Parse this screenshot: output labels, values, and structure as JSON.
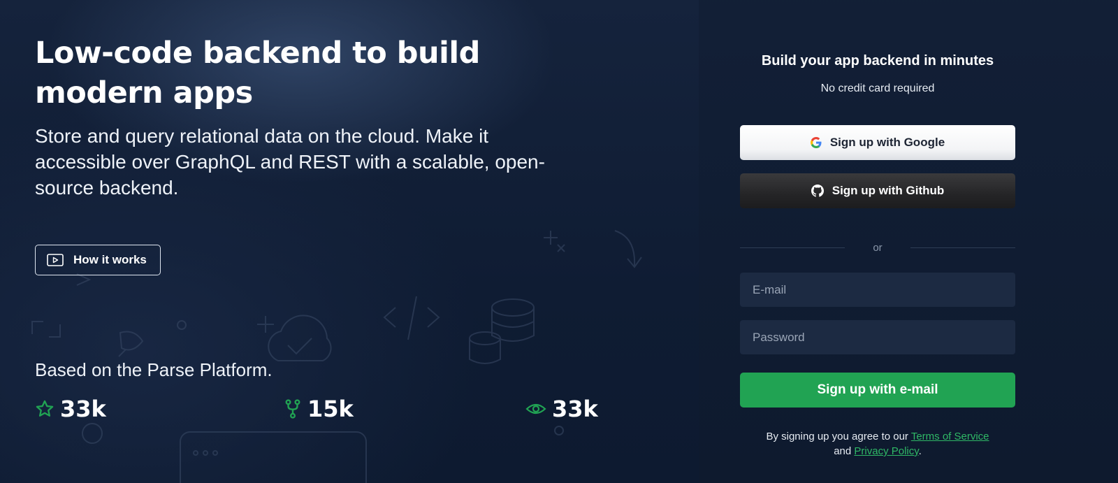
{
  "hero": {
    "headline": "Low-code backend to build modern apps",
    "subheadline": "Store and query relational data on the cloud. Make it accessible over GraphQL and REST with a scalable, open-source backend.",
    "how_it_works_label": "How it works",
    "based_on": "Based on the Parse Platform.",
    "stats": [
      {
        "icon": "star-icon",
        "value": "33k"
      },
      {
        "icon": "git-fork-icon",
        "value": "15k"
      },
      {
        "icon": "eye-icon",
        "value": "33k"
      }
    ]
  },
  "signup": {
    "title": "Build your app backend in minutes",
    "subtitle": "No credit card required",
    "google_label": "Sign up with Google",
    "github_label": "Sign up with Github",
    "or_label": "or",
    "email_placeholder": "E-mail",
    "password_placeholder": "Password",
    "email_button_label": "Sign up with e-mail",
    "legal_prefix": "By signing up you agree to our",
    "terms_link": "Terms of Service",
    "legal_and": "and",
    "privacy_link": "Privacy Policy",
    "legal_suffix": "."
  },
  "colors": {
    "background": "#0f1b30",
    "accent_green": "#21a353",
    "link_green": "#2fb866",
    "field_bg": "#1c2a42"
  }
}
